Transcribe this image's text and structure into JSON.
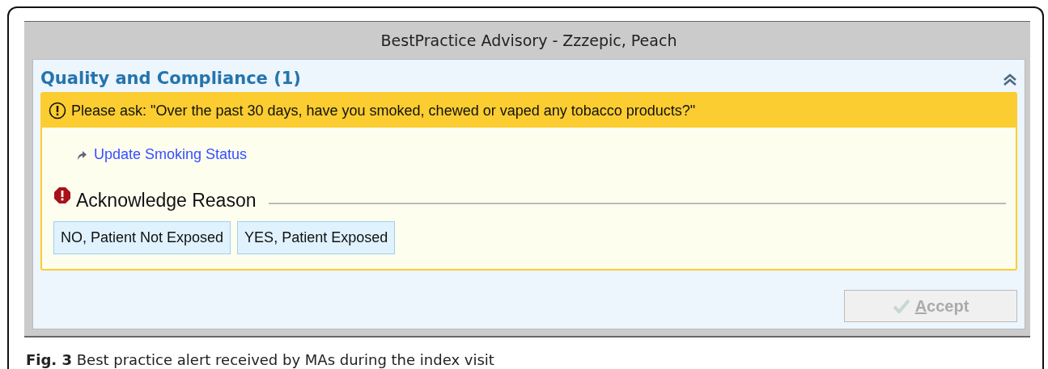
{
  "window": {
    "title": "BestPractice Advisory - Zzzepic, Peach"
  },
  "section": {
    "heading": "Quality and Compliance (1)",
    "expanded": true
  },
  "alert": {
    "message": "Please ask: \"Over the past 30 days, have you smoked, chewed or vaped any tobacco products?\"",
    "link": "Update Smoking Status"
  },
  "acknowledge": {
    "label": "Acknowledge Reason",
    "options": [
      {
        "label": "NO, Patient Not Exposed",
        "selected": false
      },
      {
        "label": "YES, Patient Exposed",
        "selected": false
      }
    ]
  },
  "accept_button": {
    "label": "Accept",
    "disabled": true
  },
  "caption": "**Fig. 3** Best practice alert received by MAs during the index visit"
}
